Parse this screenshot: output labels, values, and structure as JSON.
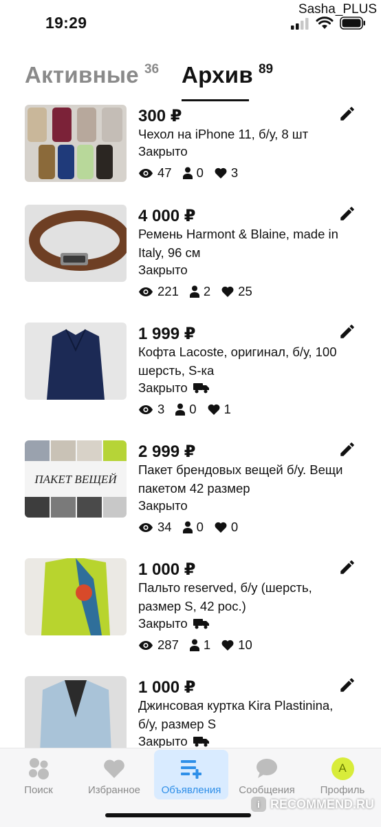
{
  "status_bar": {
    "time": "19:29",
    "username": "Sasha_PLUS"
  },
  "tabs": [
    {
      "label": "Активные",
      "count": "36",
      "active": false
    },
    {
      "label": "Архив",
      "count": "89",
      "active": true
    }
  ],
  "items": [
    {
      "price": "300 ₽",
      "title": "Чехол на iPhone 11, б/у, 8 шт",
      "status": "Закрыто",
      "delivery": false,
      "views": "47",
      "contacts": "0",
      "favorites": "3",
      "thumb_bg": "#cfc9c2"
    },
    {
      "price": "4 000 ₽",
      "title": "Ремень Harmont & Blaine, made in Italy, 96 см",
      "status": "Закрыто",
      "delivery": false,
      "views": "221",
      "contacts": "2",
      "favorites": "25",
      "thumb_bg": "#d9d9d9"
    },
    {
      "price": "1 999 ₽",
      "title": "Кофта Lacoste, оригинал, б/у, 100 шерсть, S-ка",
      "status": "Закрыто",
      "delivery": true,
      "views": "3",
      "contacts": "0",
      "favorites": "1",
      "thumb_bg": "#e3e3e3"
    },
    {
      "price": "2 999 ₽",
      "title": "Пакет брендовых вещей б/у. Вещи пакетом 42 размер",
      "status": "Закрыто",
      "delivery": false,
      "views": "34",
      "contacts": "0",
      "favorites": "0",
      "thumb_bg": "#f2f2f2",
      "thumb_caption": "ПАКЕТ ВЕЩЕЙ"
    },
    {
      "price": "1 000 ₽",
      "title": "Пальто reserved, б/у (шерсть, размер S, 42 рос.)",
      "status": "Закрыто",
      "delivery": true,
      "views": "287",
      "contacts": "1",
      "favorites": "10",
      "thumb_bg": "#e8e6e1"
    },
    {
      "price": "1 000 ₽",
      "title": "Джинсовая куртка Kira Plastinina, б/у, размер S",
      "status": "Закрыто",
      "delivery": true,
      "views": "",
      "contacts": "",
      "favorites": "",
      "thumb_bg": "#dcdcdc"
    }
  ],
  "bottom_nav": [
    {
      "label": "Поиск",
      "icon": "search-dots-icon",
      "active": false
    },
    {
      "label": "Избранное",
      "icon": "heart-icon",
      "active": false
    },
    {
      "label": "Объявления",
      "icon": "listing-add-icon",
      "active": true
    },
    {
      "label": "Сообщения",
      "icon": "chat-bubble-icon",
      "active": false
    },
    {
      "label": "Профиль",
      "icon": "avatar",
      "active": false,
      "avatar_letter": "A"
    }
  ],
  "watermark": {
    "text": "RECOMMEND.RU",
    "badge": "i"
  },
  "colors": {
    "accent": "#2f8fe8",
    "active_nav_bg": "#d9ebff",
    "inactive_text": "#8a8a8a",
    "avatar_bg": "#d8ec3a"
  }
}
